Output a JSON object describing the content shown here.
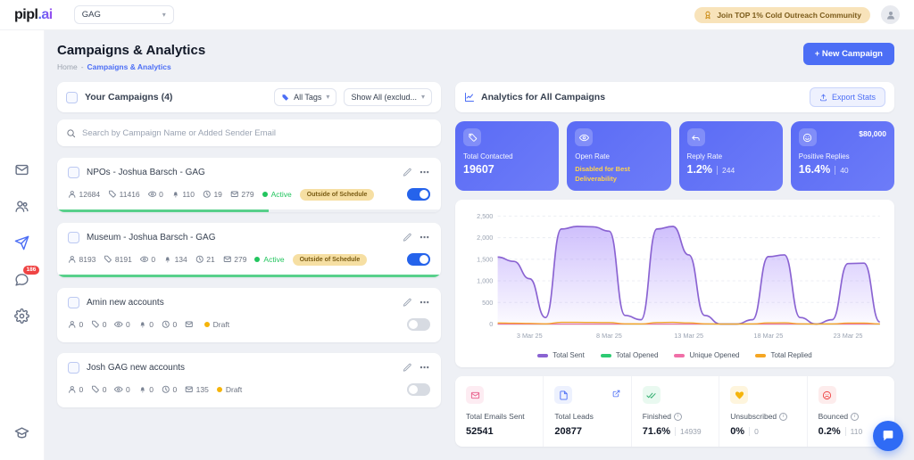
{
  "theme": {
    "accent": "#4c6ef5",
    "stat_card_gradient": [
      "#5a6bf5",
      "#6d7cf8"
    ],
    "active_green": "#22c55e",
    "draft_yellow": "#f5b40a",
    "badge_bg": "#f6dfa3"
  },
  "topbar": {
    "logo_primary": "pipl",
    "logo_secondary": ".ai",
    "workspace": "GAG",
    "promo": "Join TOP 1% Cold Outreach Community"
  },
  "sidebar": {
    "chat_badge": "186"
  },
  "page": {
    "title": "Campaigns & Analytics",
    "breadcrumb": {
      "home": "Home",
      "separator": "-",
      "current": "Campaigns & Analytics"
    },
    "new_campaign_button": "+ New Campaign"
  },
  "campaigns": {
    "header": "Your Campaigns (4)",
    "tags_filter": "All Tags",
    "show_filter": "Show All (exclud...",
    "search_placeholder": "Search by Campaign Name or Added Sender Email",
    "items": [
      {
        "name": "NPOs - Joshua Barsch - GAG",
        "stats": {
          "contacts": "12684",
          "sent": "11416",
          "opened": "0",
          "bounced": "110",
          "replied": "19",
          "emails": "279"
        },
        "status": "Active",
        "dot_color": "#22c55e",
        "status_text_color": "#22c55e",
        "badge": "Outside of Schedule",
        "toggle_on": true,
        "progress": 55
      },
      {
        "name": "Museum - Joshua Barsch - GAG",
        "stats": {
          "contacts": "8193",
          "sent": "8191",
          "opened": "0",
          "bounced": "134",
          "replied": "21",
          "emails": "279"
        },
        "status": "Active",
        "dot_color": "#22c55e",
        "status_text_color": "#22c55e",
        "badge": "Outside of Schedule",
        "toggle_on": true,
        "progress": 100
      },
      {
        "name": "Amin new accounts",
        "stats": {
          "contacts": "0",
          "sent": "0",
          "opened": "0",
          "bounced": "0",
          "replied": "0",
          "emails": ""
        },
        "status": "Draft",
        "dot_color": "#f5b40a",
        "status_text_color": "#6b7280",
        "badge": "",
        "toggle_on": false,
        "progress": null
      },
      {
        "name": "Josh GAG new accounts",
        "stats": {
          "contacts": "0",
          "sent": "0",
          "opened": "0",
          "bounced": "0",
          "replied": "0",
          "emails": "135"
        },
        "status": "Draft",
        "dot_color": "#f5b40a",
        "status_text_color": "#6b7280",
        "badge": "",
        "toggle_on": false,
        "progress": null
      }
    ]
  },
  "analytics": {
    "header": "Analytics for All Campaigns",
    "export_button": "Export Stats",
    "stat_cards": [
      {
        "label": "Total Contacted",
        "value": "19607",
        "icon": "tag-icon"
      },
      {
        "label": "Open Rate",
        "note": "Disabled for Best Deliverability",
        "icon": "eye-icon"
      },
      {
        "label": "Reply Rate",
        "value": "1.2%",
        "sub": "244",
        "icon": "reply-icon"
      },
      {
        "label": "Positive Replies",
        "value": "16.4%",
        "sub": "40",
        "corner": "$80,000",
        "icon": "smiley-icon"
      }
    ],
    "summary": [
      {
        "label": "Total Emails Sent",
        "value": "52541",
        "icon": "envelope-icon",
        "icon_color": "#e85d8a",
        "icon_bg": "#fdecf2",
        "info": false,
        "link": false
      },
      {
        "label": "Total Leads",
        "value": "20877",
        "icon": "document-icon",
        "icon_color": "#4c6ef5",
        "icon_bg": "#edf1fe",
        "info": false,
        "link": true
      },
      {
        "label": "Finished",
        "value": "71.6%",
        "sub": "14939",
        "icon": "double-check-icon",
        "icon_color": "#2fae6e",
        "icon_bg": "#e9f9f0",
        "info": true,
        "link": false
      },
      {
        "label": "Unsubscribed",
        "value": "0%",
        "sub": "0",
        "icon": "heart-icon",
        "icon_color": "#f5b40a",
        "icon_bg": "#fef5dd",
        "info": true,
        "link": false
      },
      {
        "label": "Bounced",
        "value": "0.2%",
        "sub": "110",
        "icon": "sad-face-icon",
        "icon_color": "#ef4444",
        "icon_bg": "#fdecec",
        "info": true,
        "link": false
      }
    ]
  },
  "chart_data": {
    "type": "area",
    "title": "",
    "xlabel": "",
    "ylabel": "",
    "grid": true,
    "legend_position": "bottom",
    "ylim": [
      0,
      2500
    ],
    "yticks": [
      0,
      500,
      1000,
      1500,
      2000,
      2500
    ],
    "xticks": [
      "3 Mar 25",
      "8 Mar 25",
      "13 Mar 25",
      "18 Mar 25",
      "23 Mar 25"
    ],
    "x": [
      "1 Mar 25",
      "2 Mar 25",
      "3 Mar 25",
      "4 Mar 25",
      "5 Mar 25",
      "6 Mar 25",
      "7 Mar 25",
      "8 Mar 25",
      "9 Mar 25",
      "10 Mar 25",
      "11 Mar 25",
      "12 Mar 25",
      "13 Mar 25",
      "14 Mar 25",
      "15 Mar 25",
      "16 Mar 25",
      "17 Mar 25",
      "18 Mar 25",
      "19 Mar 25",
      "20 Mar 25",
      "21 Mar 25",
      "22 Mar 25",
      "23 Mar 25",
      "24 Mar 25",
      "25 Mar 25"
    ],
    "series": [
      {
        "name": "Total Sent",
        "color": "#8a63d2",
        "fill": true,
        "values": [
          1550,
          1450,
          1050,
          150,
          2200,
          2260,
          2250,
          2150,
          200,
          100,
          2200,
          2260,
          1600,
          200,
          0,
          0,
          100,
          1560,
          1600,
          150,
          0,
          100,
          1400,
          1410,
          50
        ]
      },
      {
        "name": "Total Opened",
        "color": "#2dca72",
        "fill": false,
        "values": [
          0,
          0,
          0,
          0,
          0,
          0,
          0,
          0,
          0,
          0,
          0,
          0,
          0,
          0,
          0,
          0,
          0,
          0,
          0,
          0,
          0,
          0,
          0,
          0,
          0
        ]
      },
      {
        "name": "Unique Opened",
        "color": "#f06fa7",
        "fill": false,
        "values": [
          0,
          0,
          0,
          0,
          0,
          0,
          0,
          0,
          0,
          0,
          0,
          0,
          0,
          0,
          0,
          0,
          0,
          0,
          0,
          0,
          0,
          0,
          0,
          0,
          0
        ]
      },
      {
        "name": "Total Replied",
        "color": "#f5a623",
        "fill": false,
        "values": [
          25,
          20,
          15,
          5,
          40,
          40,
          38,
          35,
          5,
          2,
          35,
          40,
          28,
          5,
          0,
          0,
          2,
          28,
          30,
          5,
          0,
          2,
          22,
          24,
          2
        ]
      }
    ]
  }
}
